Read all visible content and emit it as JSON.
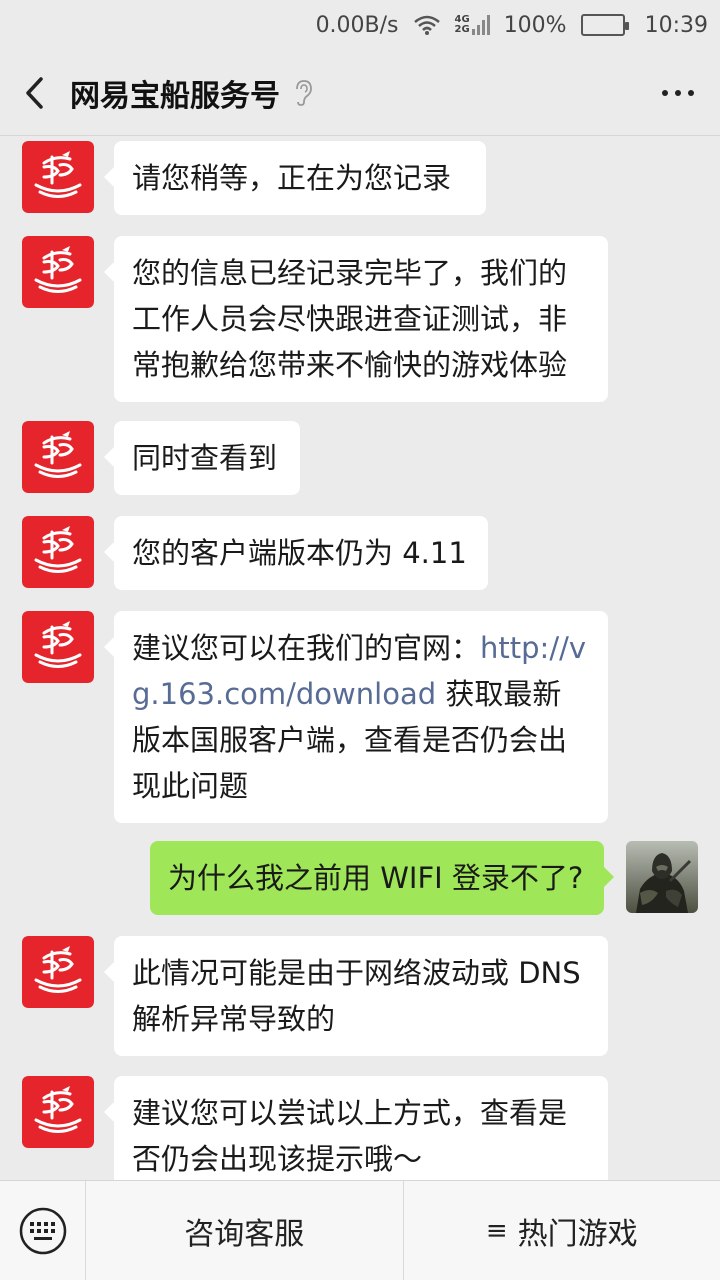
{
  "status_bar": {
    "speed": "0.00B/s",
    "network_top": "4G",
    "network_bottom": "2G",
    "battery": "100%",
    "battery_level": 1.0,
    "time": "10:39"
  },
  "header": {
    "title": "网易宝船服务号"
  },
  "messages": [
    {
      "from": "service",
      "parts": [
        "请您稍等，正在为您记录"
      ]
    },
    {
      "from": "service",
      "parts": [
        "您的信息已经记录完毕了，我们的工作人员会尽快跟进查证测试，非常抱歉给您带来不愉快的游戏体验"
      ]
    },
    {
      "from": "service",
      "parts": [
        "同时查看到"
      ]
    },
    {
      "from": "service",
      "parts": [
        "您的客户端版本仍为 4.11"
      ]
    },
    {
      "from": "service",
      "parts": [
        "建议您可以在我们的官网：",
        "http://vg.163.com/download",
        " 获取最新版本国服客户端，查看是否仍会出现此问题"
      ]
    },
    {
      "from": "user",
      "parts": [
        "为什么我之前用 WIFI 登录不了?"
      ]
    },
    {
      "from": "service",
      "parts": [
        "此情况可能是由于网络波动或 DNS 解析异常导致的"
      ]
    },
    {
      "from": "service",
      "parts": [
        "建议您可以尝试以上方式，查看是否仍会出现该提示哦～"
      ]
    }
  ],
  "bottom_bar": {
    "menu_1": "咨询客服",
    "menu_2_prefix": "≡",
    "menu_2": "热门游戏"
  },
  "colors": {
    "background": "#ebebeb",
    "service_bubble": "#ffffff",
    "user_bubble": "#9fe658",
    "brand_red": "#e5242b",
    "link": "#576b95"
  }
}
